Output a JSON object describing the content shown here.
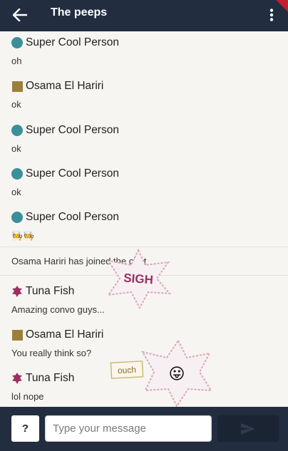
{
  "header": {
    "title": "The peeps",
    "back_icon": "arrow-left-icon",
    "menu_icon": "more-vert-icon"
  },
  "messages": [
    {
      "author": "Super Cool Person",
      "text": "oh",
      "avatar": "teal-circle"
    },
    {
      "author": "Osama El Hariri",
      "text": "ok",
      "avatar": "gold-square"
    },
    {
      "author": "Super Cool Person",
      "text": "ok",
      "avatar": "teal-circle"
    },
    {
      "author": "Super Cool Person",
      "text": "ok",
      "avatar": "teal-circle"
    },
    {
      "author": "Super Cool Person",
      "text": "🧑‍🍳🧑‍🍳",
      "avatar": "teal-circle"
    },
    {
      "author": "Tuna Fish",
      "text": "Amazing convo guys...",
      "avatar": "magenta-flower"
    },
    {
      "author": "Osama El Hariri",
      "text": "You really think so?",
      "avatar": "gold-square"
    },
    {
      "author": "Tuna Fish",
      "text": "lol nope",
      "avatar": "magenta-flower"
    }
  ],
  "system_message": "Osama Hariri has joined the chat",
  "stickers": {
    "sigh": "SIGH",
    "ouch": "ouch",
    "tongue": "😛"
  },
  "composer": {
    "help_label": "?",
    "placeholder": "Type your message"
  },
  "colors": {
    "bar": "#222d3f",
    "send": "#1b2433",
    "teal": "#3a8f9a",
    "gold": "#9b803a",
    "magenta": "#9a2f62"
  }
}
